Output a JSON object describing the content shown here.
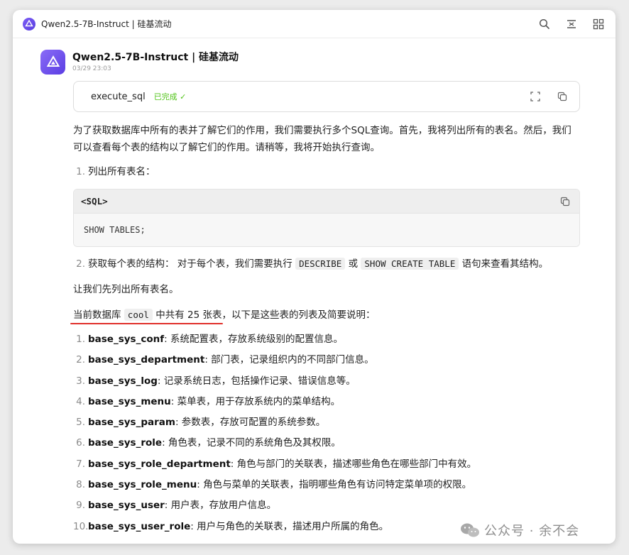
{
  "window": {
    "title": "Qwen2.5-7B-Instruct | 硅基流动"
  },
  "message": {
    "sender": "Qwen2.5-7B-Instruct | 硅基流动",
    "timestamp": "03/29 23:03",
    "tool_call": {
      "name": "execute_sql",
      "status": "已完成 ✓"
    },
    "intro": "为了获取数据库中所有的表并了解它们的作用，我们需要执行多个SQL查询。首先，我将列出所有的表名。然后，我们可以查看每个表的结构以了解它们的作用。请稍等，我将开始执行查询。",
    "step1": {
      "num": "1.",
      "text": "列出所有表名："
    },
    "code": {
      "lang": "<SQL>",
      "body": "SHOW TABLES;"
    },
    "step2": {
      "num": "2.",
      "prefix": "获取每个表的结构： 对于每个表，我们需要执行 ",
      "code1": "DESCRIBE",
      "mid": " 或 ",
      "code2": "SHOW CREATE TABLE",
      "suffix": " 语句来查看其结构。"
    },
    "list_intro": "让我们先列出所有表名。",
    "db_line": {
      "prefix": "当前数据库 ",
      "db": "cool",
      "highlight": " 中共有 25 张表",
      "suffix": "，以下是这些表的列表及简要说明："
    },
    "tables": [
      {
        "num": "1.",
        "name": "base_sys_conf",
        "desc": ": 系统配置表，存放系统级别的配置信息。"
      },
      {
        "num": "2.",
        "name": "base_sys_department",
        "desc": ": 部门表，记录组织内的不同部门信息。"
      },
      {
        "num": "3.",
        "name": "base_sys_log",
        "desc": ": 记录系统日志，包括操作记录、错误信息等。"
      },
      {
        "num": "4.",
        "name": "base_sys_menu",
        "desc": ": 菜单表，用于存放系统内的菜单结构。"
      },
      {
        "num": "5.",
        "name": "base_sys_param",
        "desc": ": 参数表，存放可配置的系统参数。"
      },
      {
        "num": "6.",
        "name": "base_sys_role",
        "desc": ": 角色表，记录不同的系统角色及其权限。"
      },
      {
        "num": "7.",
        "name": "base_sys_role_department",
        "desc": ": 角色与部门的关联表，描述哪些角色在哪些部门中有效。"
      },
      {
        "num": "8.",
        "name": "base_sys_role_menu",
        "desc": ": 角色与菜单的关联表，指明哪些角色有访问特定菜单项的权限。"
      },
      {
        "num": "9.",
        "name": "base_sys_user",
        "desc": ": 用户表，存放用户信息。"
      },
      {
        "num": "10.",
        "name": "base_sys_user_role",
        "desc": ": 用户与角色的关联表，描述用户所属的角色。"
      }
    ]
  },
  "watermark": {
    "text": "公众号 · 余不会"
  },
  "colors": {
    "accent": "#6b4ef0",
    "success": "#52c41a",
    "underline": "#e0302a"
  },
  "icons": [
    "app-logo-icon",
    "search-icon",
    "expand-icon",
    "grid-icon",
    "fullscreen-icon",
    "copy-icon",
    "wechat-icon"
  ]
}
